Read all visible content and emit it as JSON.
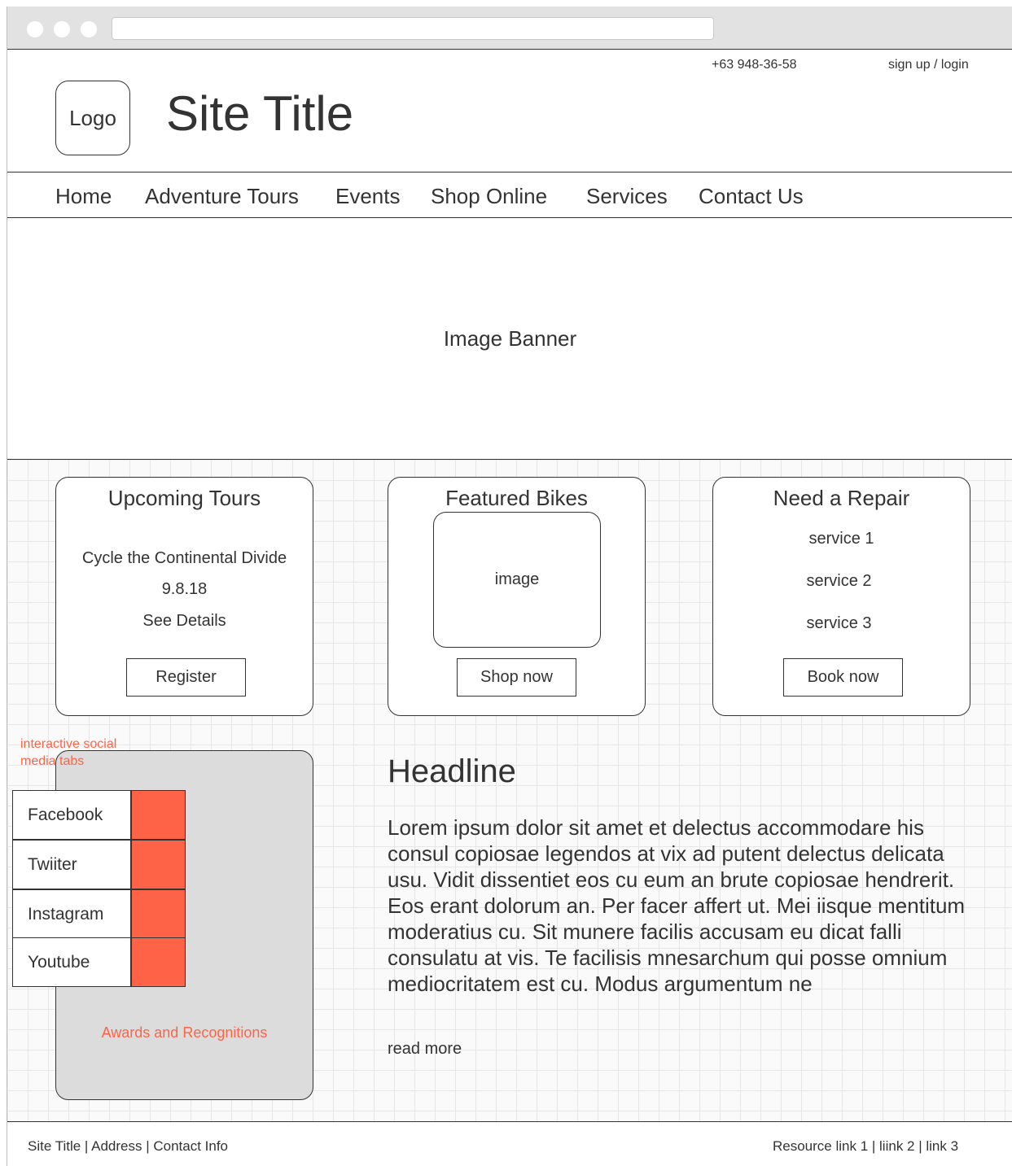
{
  "header": {
    "phone": "+63 948-36-58",
    "login": "sign up / login",
    "logo": "Logo",
    "site_title": "Site Title"
  },
  "nav": {
    "items": [
      "Home",
      "Adventure Tours",
      "Events",
      "Shop Online",
      "Services",
      "Contact Us"
    ]
  },
  "banner": {
    "label": "Image Banner"
  },
  "cards": {
    "tours": {
      "title": "Upcoming Tours",
      "tour_name": "Cycle the Continental Divide",
      "date": "9.8.18",
      "details": "See Details",
      "button": "Register"
    },
    "bikes": {
      "title": "Featured Bikes",
      "image": "image",
      "button": "Shop now"
    },
    "repair": {
      "title": "Need a Repair",
      "services": [
        "service 1",
        "service 2",
        "service 3"
      ],
      "button": "Book now"
    }
  },
  "social": {
    "note": "interactive social media tabs",
    "tabs": [
      "Facebook",
      "Twiiter",
      "Instagram",
      "Youtube"
    ],
    "awards": "Awards and Recognitions",
    "accent_color": "#ff6347"
  },
  "article": {
    "headline": "Headline",
    "body": "Lorem ipsum dolor sit amet et delectus accommodare his consul copiosae legendos at vix ad putent delectus delicata usu. Vidit dissentiet eos cu eum an brute copiosae hendrerit. Eos erant dolorum an. Per facer affert ut. Mei iisque mentitum moderatius cu. Sit munere facilis accusam eu dicat falli consulatu at vis. Te facilisis mnesarchum qui posse omnium mediocritatem est cu. Modus argumentum ne",
    "read_more": "read more"
  },
  "footer": {
    "left": "Site Title | Address | Contact Info",
    "right": "Resource link 1 | liink 2 | link 3"
  }
}
